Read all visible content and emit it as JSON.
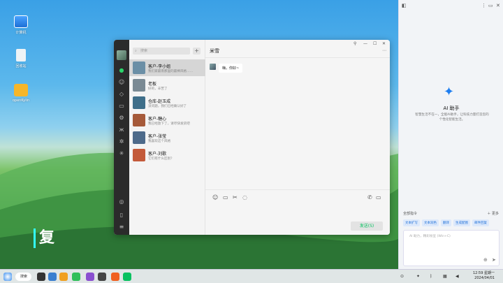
{
  "desktop": {
    "icons": [
      {
        "label": "计算机"
      },
      {
        "label": "回收站"
      },
      {
        "label": "openKylin"
      }
    ],
    "overlay_text": "复"
  },
  "chat": {
    "search_placeholder": "搜索",
    "add_icon": "plus-icon",
    "conversations": [
      {
        "name": "客户-李小姐",
        "preview": "我们家最南那里的最棒风格……",
        "selected": true,
        "color": "#6b8fa6"
      },
      {
        "name": "老板",
        "preview": "好的，辛苦了",
        "selected": false,
        "color": "#7a8a94"
      },
      {
        "name": "仓库-赵玉成",
        "preview": "没问题，我们已经确认好了",
        "selected": false,
        "color": "#3f6f8a"
      },
      {
        "name": "客户-糖心",
        "preview": "我已经放下了，请尽快发货吧",
        "selected": false,
        "color": "#a65a3a"
      },
      {
        "name": "客户-张莹",
        "preview": "我喜欢这个风格",
        "selected": false,
        "color": "#4d6a8a"
      },
      {
        "name": "客户-刘歌",
        "preview": "它们有什么区别？",
        "selected": false,
        "color": "#c35a3a"
      }
    ],
    "current_title": "米雪",
    "messages": [
      {
        "text": "嗨，你好~"
      }
    ],
    "send_label": "发送(S)"
  },
  "assistant": {
    "title": "AI 助手",
    "subtitle": "智慧生活不在一，全能AI助手，让科技力量打造您的个性化智能生活。",
    "commands_label": "全部指令",
    "more_label": "更多",
    "chips": [
      "文本扩写",
      "文本润色",
      "翻译",
      "生成配图",
      "邮件回复"
    ],
    "input_placeholder": "AI 助力，精彩纷呈 (Win+C)"
  },
  "taskbar": {
    "search_label": "搜索",
    "time": "12:59 星期一",
    "date": "2024/04/01"
  }
}
